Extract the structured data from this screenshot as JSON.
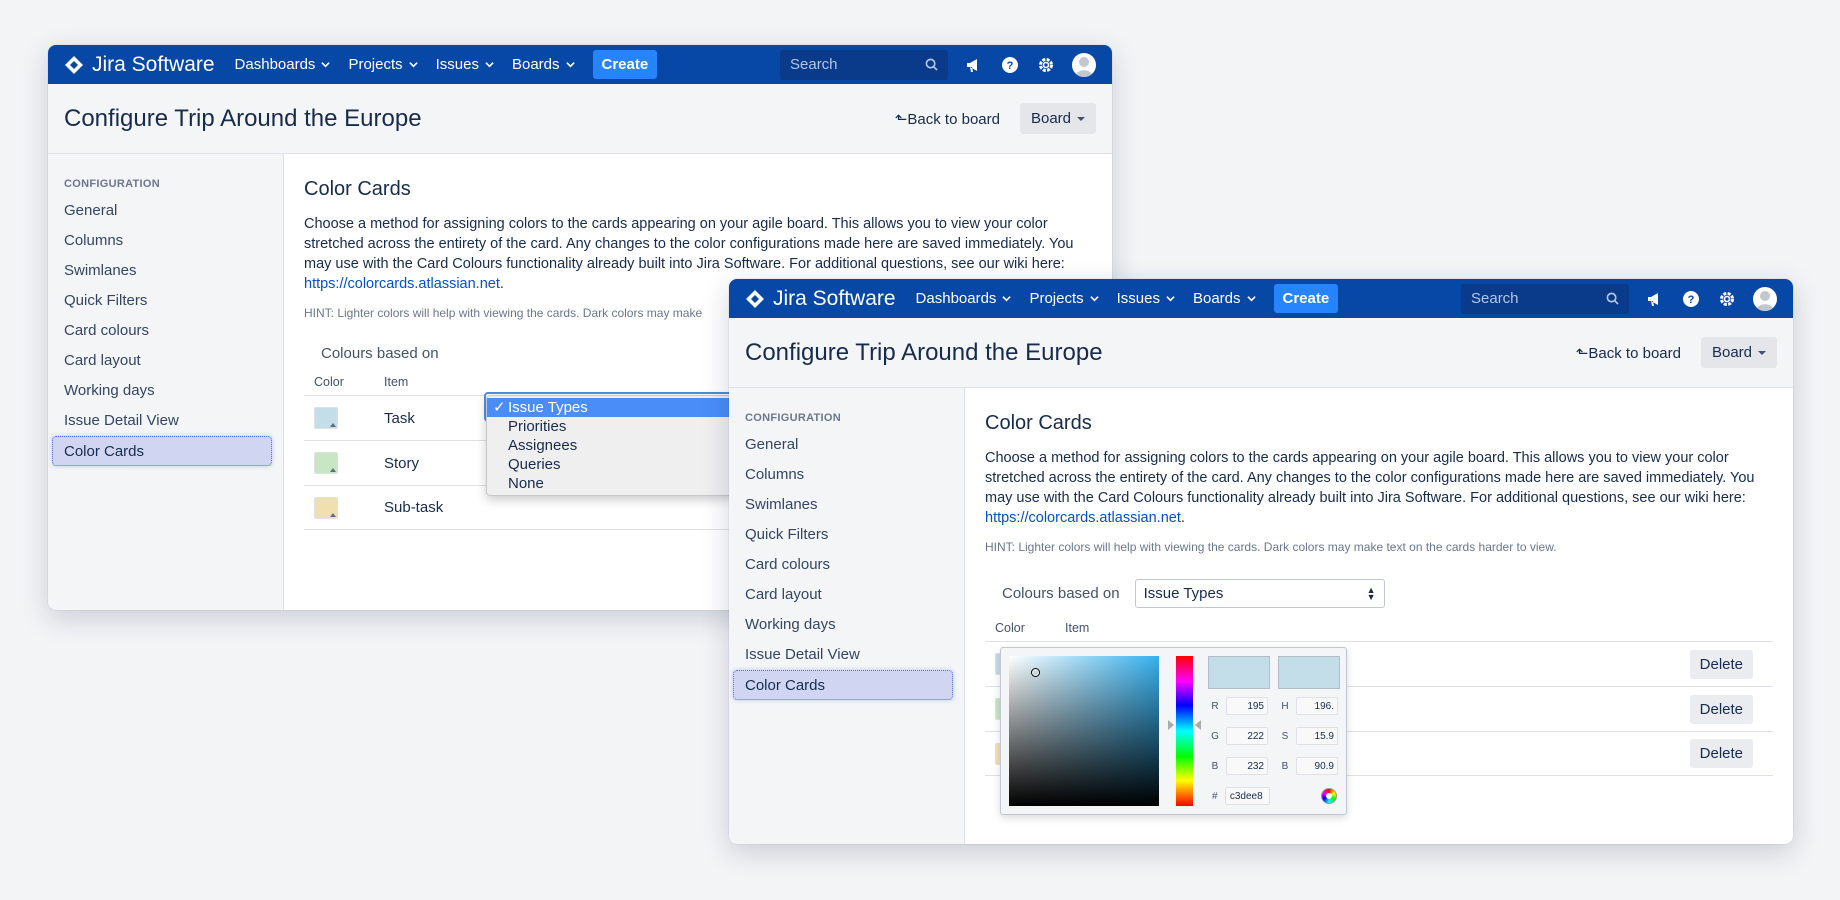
{
  "nav": {
    "brand": "Jira Software",
    "items": [
      "Dashboards",
      "Projects",
      "Issues",
      "Boards"
    ],
    "create": "Create",
    "search_placeholder": "Search"
  },
  "header": {
    "title": "Configure Trip Around the Europe",
    "back": "Back to board",
    "board": "Board"
  },
  "sidebar": {
    "heading": "CONFIGURATION",
    "items": [
      "General",
      "Columns",
      "Swimlanes",
      "Quick Filters",
      "Card colours",
      "Card layout",
      "Working days",
      "Issue Detail View",
      "Color Cards"
    ],
    "active": "Color Cards"
  },
  "main": {
    "title": "Color Cards",
    "description": "Choose a method for assigning colors to the cards appearing on your agile board. This allows you to view your color stretched across the entirety of the card. Any changes to the color configurations made here are saved immediately. You may use with the Card Colours functionality already built into Jira Software. For additional questions, see our wiki here: ",
    "link": "https://colorcards.atlassian.net",
    "link_suffix": ".",
    "hint": "HINT: Lighter colors will help with viewing the cards. Dark colors may make text on the cards harder to view.",
    "hint_truncated": "HINT: Lighter colors will help with viewing the cards. Dark colors may make",
    "colours_label": "Colours based on",
    "selected": "Issue Types",
    "options": [
      "Issue Types",
      "Priorities",
      "Assignees",
      "Queries",
      "None"
    ],
    "col_color": "Color",
    "col_item": "Item",
    "rows": [
      {
        "name": "Task",
        "color": "#c3dee8"
      },
      {
        "name": "Story",
        "color": "#c8e6c4"
      },
      {
        "name": "Sub-task",
        "color": "#f0e0b0"
      }
    ],
    "delete": "Delete"
  },
  "picker": {
    "r": "195",
    "g": "222",
    "b": "232",
    "h": "196.",
    "s": "15.9",
    "bv": "90.9",
    "hex": "c3dee8",
    "labels": {
      "r": "R",
      "g": "G",
      "b": "B",
      "h": "H",
      "s": "S",
      "bv": "B",
      "hash": "#"
    }
  },
  "colors": {
    "nav": "#0747a6",
    "create": "#2684ff",
    "active_side": "#d0d6f2"
  }
}
